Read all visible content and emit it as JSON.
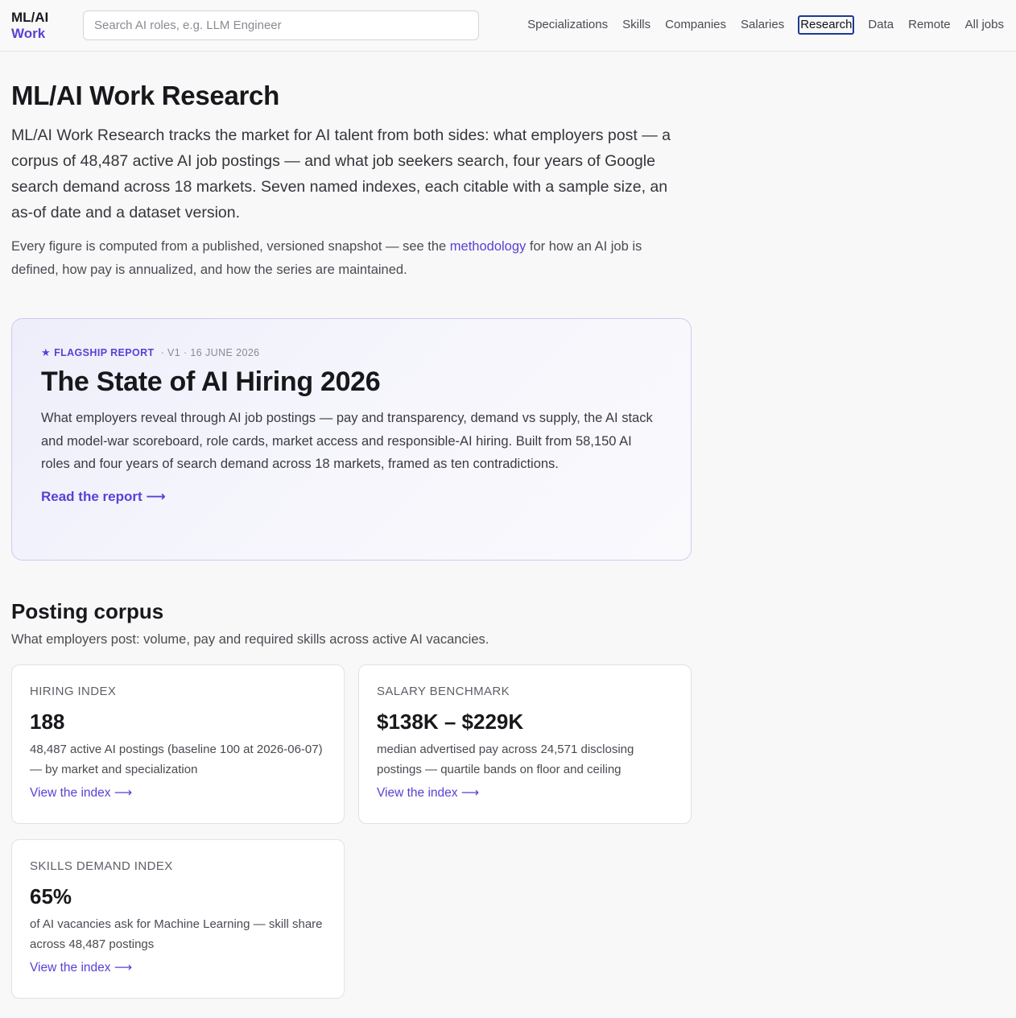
{
  "header": {
    "logo_line1": "ML/AI",
    "logo_line2": "Work",
    "search_placeholder": "Search AI roles, e.g. LLM Engineer",
    "nav": [
      "Specializations",
      "Skills",
      "Companies",
      "Salaries",
      "Research",
      "Data",
      "Remote",
      "All jobs"
    ],
    "active_nav": "Research"
  },
  "page": {
    "title": "ML/AI Work Research",
    "lead": "ML/AI Work Research tracks the market for AI talent from both sides: what employers post — a corpus of 48,487 active AI job postings — and what job seekers search, four years of Google search demand across 18 markets. Seven named indexes, each citable with a sample size, an as-of date and a dataset version.",
    "sub_before": "Every figure is computed from a published, versioned snapshot — see the ",
    "sub_link": "methodology",
    "sub_after": " for how an AI job is defined, how pay is annualized, and how the series are maintained."
  },
  "flagship": {
    "tag": "FLAGSHIP REPORT",
    "meta": "· V1 · 16 JUNE 2026",
    "title": "The State of AI Hiring 2026",
    "description": "What employers reveal through AI job postings — pay and transparency, demand vs supply, the AI stack and model-war scoreboard, role cards, market access and responsible-AI hiring. Built from 58,150 AI roles and four years of search demand across 18 markets, framed as ten contradictions.",
    "link": "Read the report ⟶"
  },
  "posting_corpus": {
    "title": "Posting corpus",
    "subtitle": "What employers post: volume, pay and required skills across active AI vacancies.",
    "cards": [
      {
        "label": "HIRING INDEX",
        "value": "188",
        "description": "48,487 active AI postings (baseline 100 at 2026-06-07) — by market and specialization",
        "link": "View the index ⟶"
      },
      {
        "label": "SALARY BENCHMARK",
        "value": "$138K – $229K",
        "description": "median advertised pay across 24,571 disclosing postings — quartile bands on floor and ceiling",
        "link": "View the index ⟶"
      },
      {
        "label": "SKILLS DEMAND INDEX",
        "value": "65%",
        "description": "of AI vacancies ask for Machine Learning — skill share across 48,487 postings",
        "link": "View the index ⟶"
      }
    ]
  },
  "colors": {
    "accent": "#5a3fd6",
    "active_nav_border": "#1d3b8f",
    "background": "#f8f8f9"
  }
}
